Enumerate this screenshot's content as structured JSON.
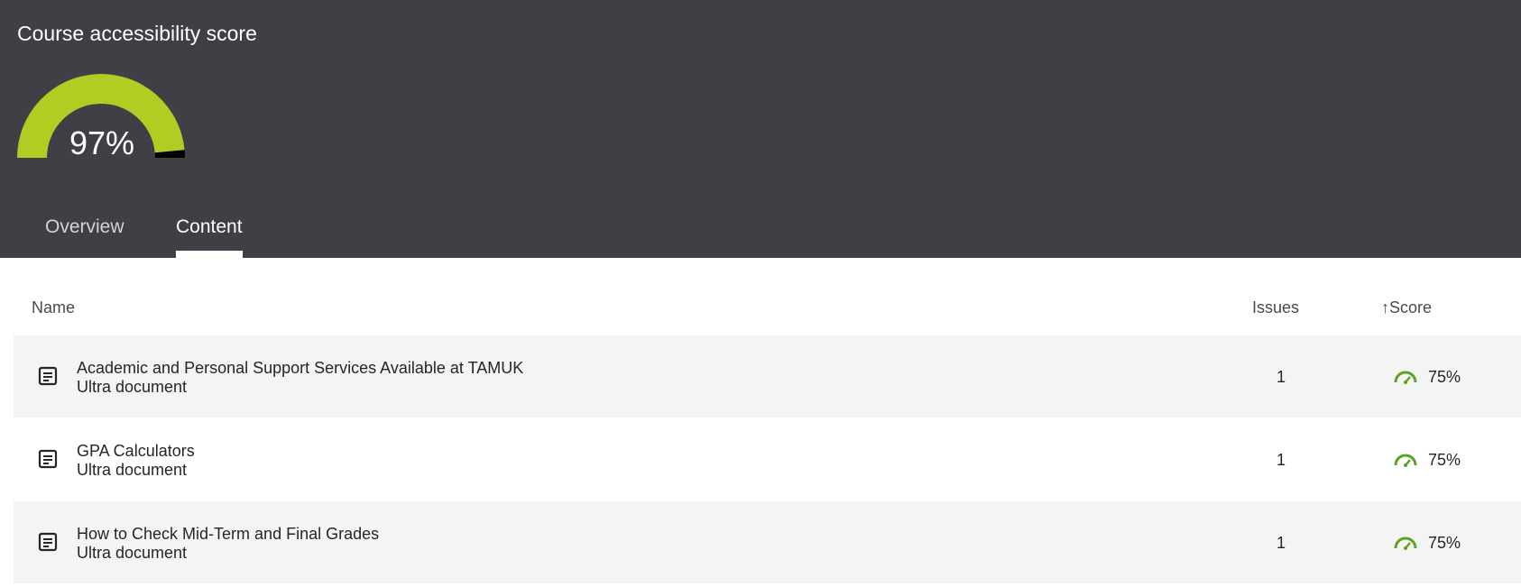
{
  "header": {
    "title": "Course accessibility score",
    "gauge": {
      "value_label": "97%",
      "fraction": 0.97,
      "fill_color": "#b2cc24",
      "remainder_color": "#000000"
    }
  },
  "tabs": [
    {
      "label": "Overview",
      "active": false
    },
    {
      "label": "Content",
      "active": true
    }
  ],
  "table": {
    "columns": {
      "name": "Name",
      "issues": "Issues",
      "score_sort_icon": "arrow-up-icon",
      "score": "Score"
    },
    "rows": [
      {
        "icon": "document-icon",
        "name": "Academic and Personal Support Services Available at TAMUK",
        "type": "Ultra document",
        "issues": "1",
        "score_icon": "speedometer-icon",
        "score": "75%"
      },
      {
        "icon": "document-icon",
        "name": "GPA Calculators",
        "type": "Ultra document",
        "issues": "1",
        "score_icon": "speedometer-icon",
        "score": "75%"
      },
      {
        "icon": "document-icon",
        "name": "How to Check Mid-Term and Final Grades",
        "type": "Ultra document",
        "issues": "1",
        "score_icon": "speedometer-icon",
        "score": "75%"
      }
    ]
  },
  "colors": {
    "header_bg": "#3f4045",
    "score_icon": "#5aa323",
    "row_shade": "#f4f4f4"
  }
}
